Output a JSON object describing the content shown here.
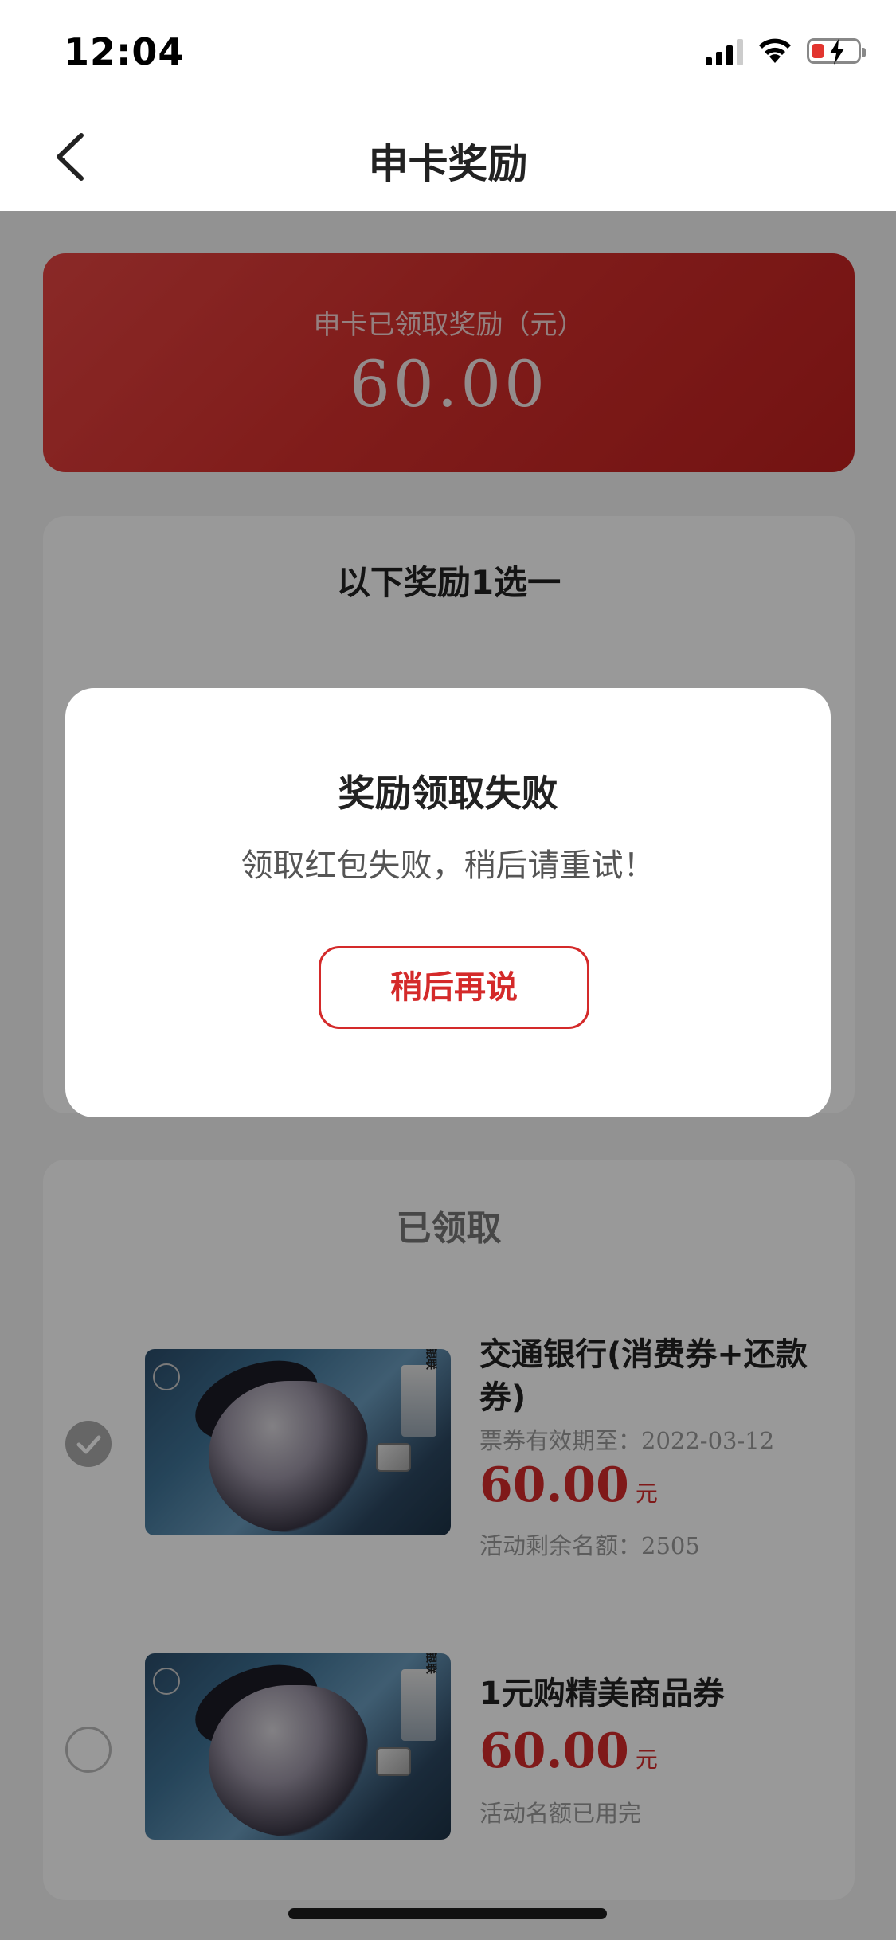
{
  "status_bar": {
    "time": "12:04"
  },
  "nav": {
    "title": "申卡奖励"
  },
  "reward": {
    "label": "申卡已领取奖励（元）",
    "amount": "60.00"
  },
  "choose_panel": {
    "title": "以下奖励1选一"
  },
  "received_panel": {
    "title": "已领取",
    "coupons": [
      {
        "name": "交通银行(消费券+还款券)",
        "validity": "票券有效期至：2022-03-12",
        "price": "60.00",
        "unit": "元",
        "quota": "活动剩余名额：2505",
        "selected": true
      },
      {
        "name": "1元购精美商品券",
        "price": "60.00",
        "unit": "元",
        "quota": "活动名额已用完",
        "selected": false
      }
    ]
  },
  "dialog": {
    "title": "奖励领取失败",
    "message": "领取红包失败，稍后请重试！",
    "button_label": "稍后再说"
  },
  "colors": {
    "accent_red": "#d42a2a",
    "overlay": "rgba(0,0,0,0.4)"
  }
}
